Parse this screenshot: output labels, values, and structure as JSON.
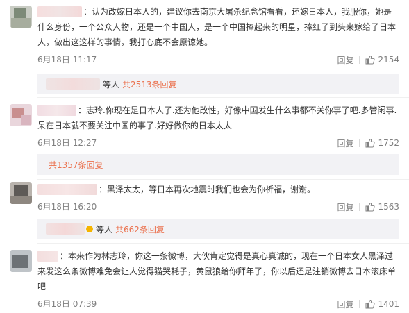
{
  "comments": [
    {
      "text": "：认为改嫁日本人的，建议你去南京大屠杀纪念馆看看，还嫁日本人，我服你，她是什么身份，一个公众人物，还是一个中国人，是一个中国捧起来的明星，捧红了到头来嫁给了日本人，做出这这样的事情，我打心底不会原谅她。",
      "time": "6月18日 11:17",
      "reply_label": "回复",
      "likes": "2154",
      "sub_who": "等人",
      "sub_more": "共2513条回复"
    },
    {
      "text": "：志玲.你现在是日本人了.还为他改性，好像中国发生什么事都不关你事了吧.多管闲事.呆在日本就不要关注中国的事了.好好做你的日本太太",
      "time": "6月18日 12:27",
      "reply_label": "回复",
      "likes": "1752",
      "sub_who": "",
      "sub_more": "共1357条回复"
    },
    {
      "text": "：黑泽太太，等日本再次地震时我们也会为你祈福，谢谢。",
      "time": "6月18日 16:20",
      "reply_label": "回复",
      "likes": "1563",
      "sub_who": "等人",
      "sub_more": "共662条回复"
    },
    {
      "text": "：本来作为林志玲，你这一条微博，大伙肯定觉得是真心真诚的，现在一个日本女人黑泽过来发这么条微博难免会让人觉得猫哭耗子，黄鼠狼给你拜年了，你以后还是注销微博去日本滚床单吧",
      "time": "6月18日 07:39",
      "reply_label": "回复",
      "likes": "1401",
      "sub_who": "",
      "sub_more": ""
    }
  ],
  "colors": {
    "link": "#eb7350",
    "muted": "#808080",
    "sub_bg": "#f2f2f5"
  },
  "icons": {
    "like": "thumbs-up-icon"
  }
}
